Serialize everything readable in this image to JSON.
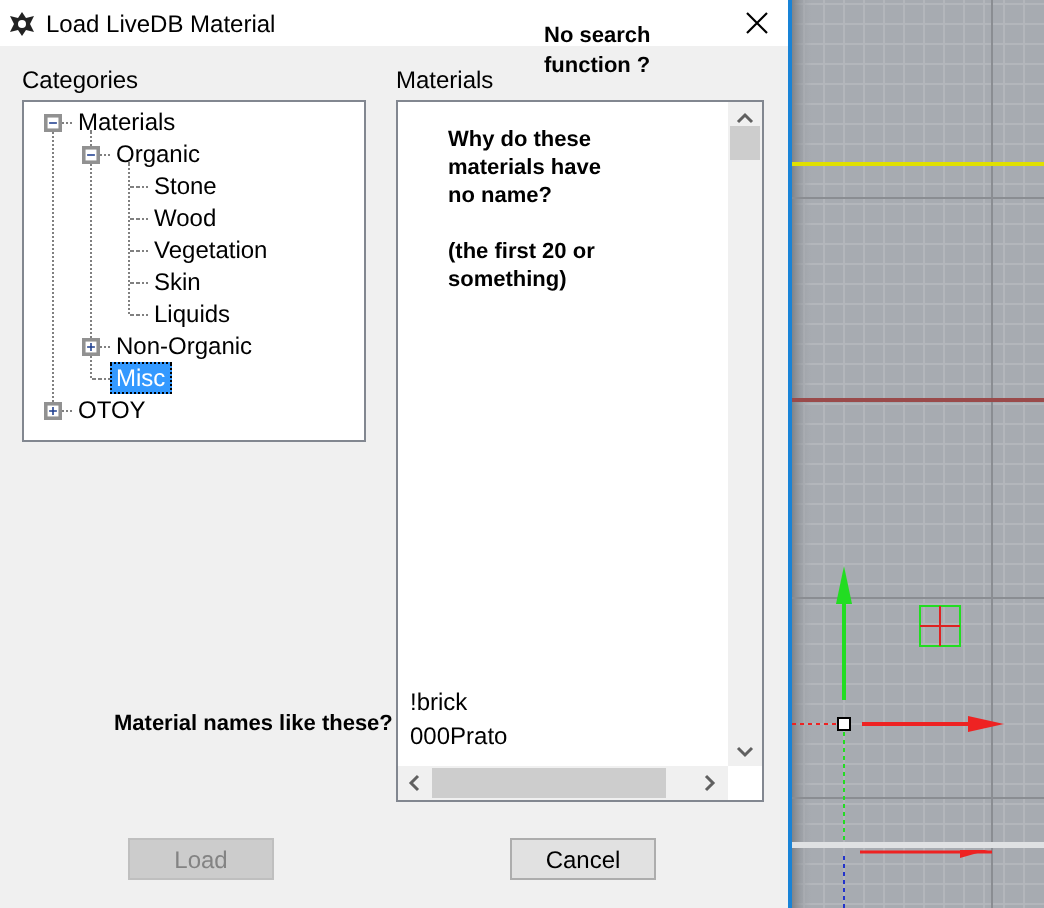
{
  "window": {
    "title": "Load LiveDB Material"
  },
  "categories": {
    "label": "Categories",
    "tree": [
      {
        "label": "Materials",
        "expanded": true,
        "selected": false,
        "children": [
          {
            "label": "Organic",
            "expanded": true,
            "selected": false,
            "children": [
              {
                "label": "Stone",
                "selected": false
              },
              {
                "label": "Wood",
                "selected": false
              },
              {
                "label": "Vegetation",
                "selected": false
              },
              {
                "label": "Skin",
                "selected": false
              },
              {
                "label": "Liquids",
                "selected": false
              }
            ]
          },
          {
            "label": "Non-Organic",
            "expanded": false,
            "selected": false
          },
          {
            "label": "Misc",
            "selected": true
          }
        ]
      },
      {
        "label": "OTOY",
        "expanded": false,
        "selected": false
      }
    ]
  },
  "materials": {
    "label": "Materials",
    "note": "Why do these\nmaterials have\nno name?\n\n(the first 20 or\nsomething)",
    "items": [
      {
        "label": "!brick",
        "selected": false
      },
      {
        "label": "000Prato",
        "selected": false
      }
    ]
  },
  "buttons": [
    {
      "label": "Load",
      "disabled": true
    },
    {
      "label": "Cancel",
      "disabled": false
    }
  ],
  "annotations": [
    {
      "kind": "top",
      "text": "No search\nfunction ?"
    },
    {
      "kind": "left",
      "text": "Material names like these?"
    }
  ]
}
